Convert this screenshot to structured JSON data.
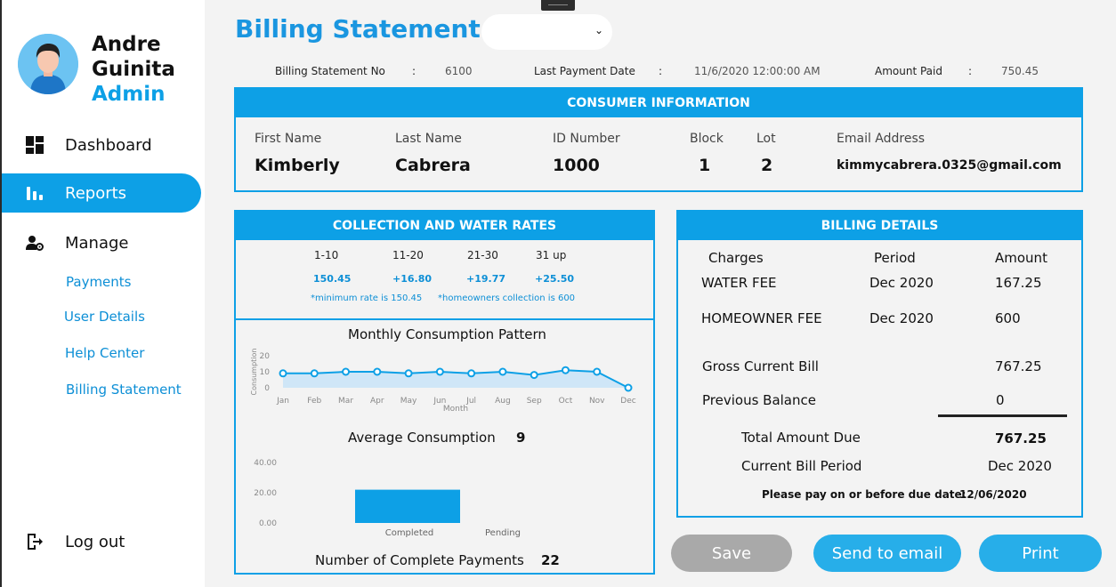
{
  "user": {
    "first_name": "Andre",
    "last_name": "Guinita",
    "role": "Admin"
  },
  "nav": {
    "dashboard": "Dashboard",
    "reports": "Reports",
    "manage": "Manage",
    "payments": "Payments",
    "user_details": "User Details",
    "help_center": "Help Center",
    "billing_statement": "Billing Statement",
    "logout": "Log out"
  },
  "header": {
    "title": "Billing Statement",
    "select_value": ""
  },
  "meta": {
    "statement_no_label": "Billing Statement No",
    "statement_no": "6100",
    "last_payment_label": "Last Payment Date",
    "last_payment": "11/6/2020 12:00:00 AM",
    "amount_paid_label": "Amount Paid",
    "amount_paid": "750.45",
    "sep": ":"
  },
  "consumer": {
    "title": "CONSUMER INFORMATION",
    "first_name_label": "First Name",
    "first_name": "Kimberly",
    "last_name_label": "Last Name",
    "last_name": "Cabrera",
    "id_label": "ID Number",
    "id": "1000",
    "block_label": "Block",
    "block": "1",
    "lot_label": "Lot",
    "lot": "2",
    "email_label": "Email Address",
    "email": "kimmycabrera.0325@gmail.com"
  },
  "rates": {
    "title": "COLLECTION AND WATER RATES",
    "items": [
      {
        "range": "1-10",
        "value": "150.45"
      },
      {
        "range": "11-20",
        "value": "+16.80"
      },
      {
        "range": "21-30",
        "value": "+19.77"
      },
      {
        "range": "31 up",
        "value": "+25.50"
      }
    ],
    "note_min": "*minimum rate is 150.45",
    "note_hoa": "*homeowners collection is 600"
  },
  "chart_data": [
    {
      "type": "area",
      "title": "Monthly Consumption Pattern",
      "xlabel": "Month",
      "ylabel": "Consumption",
      "categories": [
        "Jan",
        "Feb",
        "Mar",
        "Apr",
        "May",
        "Jun",
        "Jul",
        "Aug",
        "Sep",
        "Oct",
        "Nov",
        "Dec"
      ],
      "values": [
        9,
        9,
        10,
        10,
        9,
        10,
        9,
        10,
        8,
        11,
        10,
        0
      ],
      "yticks": [
        "0",
        "10",
        "20"
      ],
      "ylim": [
        0,
        20
      ]
    },
    {
      "type": "bar",
      "categories": [
        "Completed",
        "Pending"
      ],
      "values": [
        22,
        0
      ],
      "yticks": [
        "0.00",
        "20.00",
        "40.00"
      ],
      "ylim": [
        0,
        40
      ]
    }
  ],
  "consumption": {
    "avg_label": "Average Consumption",
    "avg_value": "9",
    "payments_label": "Number of Complete Payments",
    "payments_value": "22"
  },
  "billing": {
    "title": "BILLING DETAILS",
    "col_charges": "Charges",
    "col_period": "Period",
    "col_amount": "Amount",
    "water_label": "WATER FEE",
    "water_period": "Dec 2020",
    "water_amount": "167.25",
    "hoa_label": "HOMEOWNER FEE",
    "hoa_period": "Dec 2020",
    "hoa_amount": "600",
    "gross_label": "Gross Current Bill",
    "gross_amount": "767.25",
    "prev_label": "Previous Balance",
    "prev_amount": "0",
    "total_label": "Total Amount Due",
    "total_amount": "767.25",
    "period_label": "Current Bill Period",
    "period_value": "Dec 2020",
    "due_label": "Please pay on or before due date:",
    "due_date": "12/06/2020"
  },
  "buttons": {
    "save": "Save",
    "send": "Send to email",
    "print": "Print"
  },
  "colors": {
    "accent": "#0da0e6",
    "save_disabled": "#a9a9a9",
    "button_blue": "#27aee9"
  }
}
